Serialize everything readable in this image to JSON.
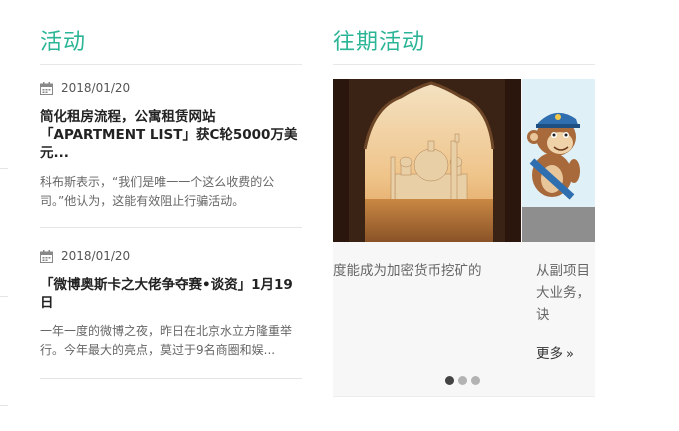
{
  "activities": {
    "title": "活动",
    "articles": [
      {
        "date": "2018/01/20",
        "title": "简化租房流程，公寓租赁网站「APARTMENT LIST」获C轮5000万美元...",
        "excerpt": "科布斯表示，“我们是唯一一个这么收费的公司。”他认为，这能有效阻止行骗活动。"
      },
      {
        "date": "2018/01/20",
        "title": "「微博奥斯卡之大佬争夺赛•谈资」1月19日",
        "excerpt": "一年一度的微博之夜，昨日在北京水立方隆重举行。今年最大的亮点，莫过于9名商圈和娱..."
      }
    ]
  },
  "past_activities": {
    "title": "往期活动",
    "slides": [
      {
        "caption": "度能成为加密货币挖矿的"
      },
      {
        "caption": "从副项目大业务，诀",
        "more_label": "更多"
      }
    ],
    "active_dot": 0,
    "dot_count": 3
  },
  "colors": {
    "accent": "#2bb596"
  }
}
